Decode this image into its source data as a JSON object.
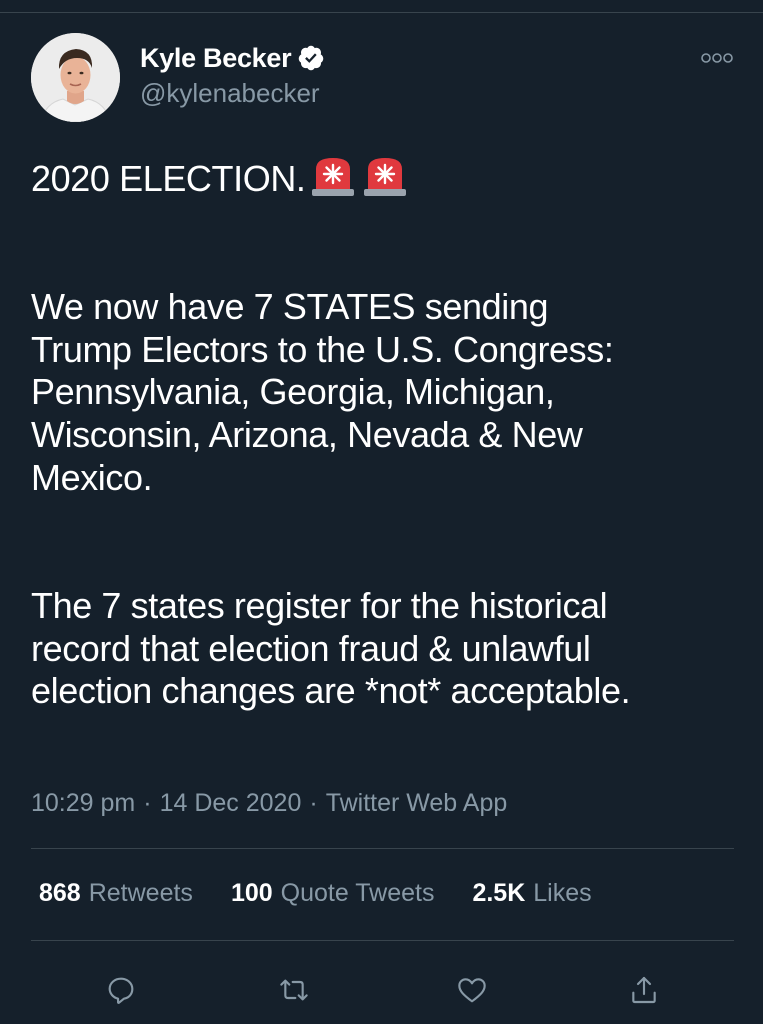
{
  "tweet": {
    "author": {
      "display_name": "Kyle Becker",
      "handle": "@kylenabecker",
      "verified_icon": "verified-badge-icon",
      "avatar": "profile-photo"
    },
    "text": {
      "headline": "2020 ELECTION.",
      "headline_emoji": [
        "police-car-light-icon",
        "police-car-light-icon"
      ],
      "paragraph_2": [
        "We now have 7 STATES sending",
        "Trump Electors to the U.S. Congress:",
        "Pennsylvania, Georgia, Michigan,",
        "Wisconsin, Arizona, Nevada & New",
        "Mexico."
      ],
      "paragraph_3": [
        "The 7 states register for the historical",
        "record that election fraud & unlawful",
        "election changes are *not* acceptable."
      ]
    },
    "meta": {
      "time": "10:29 pm",
      "separator": "·",
      "date": "14 Dec 2020",
      "source": "Twitter Web App"
    },
    "stats": {
      "retweets": {
        "count": "868",
        "label": "Retweets"
      },
      "quote_tweets": {
        "count": "100",
        "label": "Quote Tweets"
      },
      "likes": {
        "count": "2.5K",
        "label": "Likes"
      }
    },
    "actions": [
      "reply-icon",
      "retweet-icon",
      "like-icon",
      "share-icon"
    ]
  },
  "colors": {
    "background": "#15202b",
    "text_primary": "#ffffff",
    "text_secondary": "#8899a6",
    "divider": "#38444d",
    "verified_badge": "#ffffff"
  }
}
